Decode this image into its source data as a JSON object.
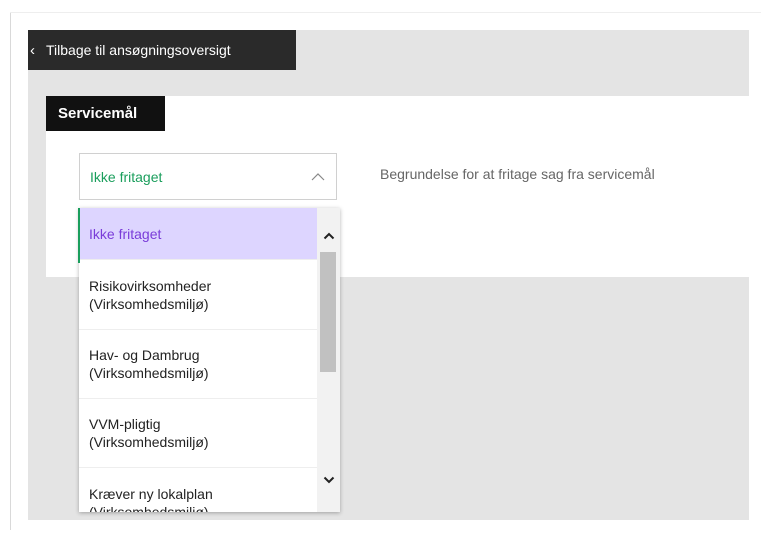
{
  "back_link": {
    "label": "Tilbage til ansøgningsoversigt",
    "icon": "chevron-left-icon"
  },
  "section": {
    "title": "Servicemål"
  },
  "select": {
    "value": "Ikke fritaget",
    "icon": "chevron-up-icon"
  },
  "reason_label": "Begrundelse for at fritage sag fra servicemål",
  "options": [
    {
      "line1": "Ikke fritaget",
      "line2": ""
    },
    {
      "line1": "Risikovirksomheder",
      "line2": "(Virksomhedsmiljø)"
    },
    {
      "line1": "Hav- og Dambrug",
      "line2": "(Virksomhedsmiljø)"
    },
    {
      "line1": "VVM-pligtig",
      "line2": "(Virksomhedsmiljø)"
    },
    {
      "line1": "Kræver ny lokalplan",
      "line2": "(Virksomhedsmiljø)"
    }
  ],
  "colors": {
    "selected_bg": "#ddd5ff",
    "selected_text": "#7a3cd9",
    "value_green": "#1a9e5c",
    "dark": "#2a2a2a"
  }
}
